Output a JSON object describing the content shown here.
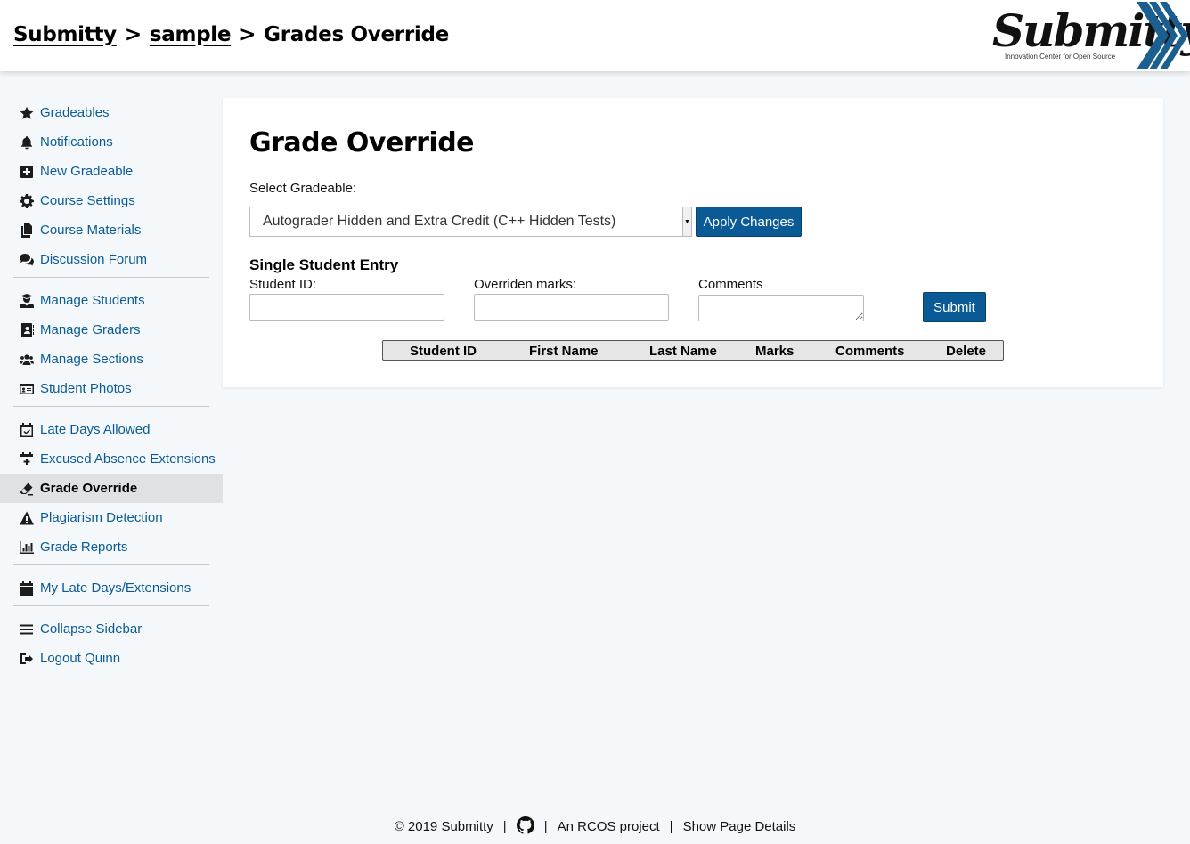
{
  "header": {
    "breadcrumb": [
      {
        "label": "Submitty"
      },
      {
        "label": "sample"
      },
      {
        "label": "Grades Override"
      }
    ],
    "separator": ">",
    "logo_text": "Submitty",
    "logo_tagline": "Innovation Center for Open Source"
  },
  "sidebar": {
    "groups": [
      [
        {
          "label": "Gradeables",
          "icon": "star-icon"
        },
        {
          "label": "Notifications",
          "icon": "bell-icon"
        },
        {
          "label": "New Gradeable",
          "icon": "plus-square-icon"
        },
        {
          "label": "Course Settings",
          "icon": "gear-icon"
        },
        {
          "label": "Course Materials",
          "icon": "copy-icon"
        },
        {
          "label": "Discussion Forum",
          "icon": "comments-icon"
        }
      ],
      [
        {
          "label": "Manage Students",
          "icon": "user-graduate-icon"
        },
        {
          "label": "Manage Graders",
          "icon": "address-book-icon"
        },
        {
          "label": "Manage Sections",
          "icon": "users-icon"
        },
        {
          "label": "Student Photos",
          "icon": "id-card-icon"
        }
      ],
      [
        {
          "label": "Late Days Allowed",
          "icon": "calendar-check-icon"
        },
        {
          "label": "Excused Absence Extensions",
          "icon": "calendar-plus-icon"
        },
        {
          "label": "Grade Override",
          "icon": "eraser-icon",
          "active": true
        },
        {
          "label": "Plagiarism Detection",
          "icon": "warning-icon"
        },
        {
          "label": "Grade Reports",
          "icon": "chart-bar-icon"
        }
      ],
      [
        {
          "label": "My Late Days/Extensions",
          "icon": "calendar-icon"
        }
      ],
      [
        {
          "label": "Collapse Sidebar",
          "icon": "bars-icon"
        },
        {
          "label": "Logout Quinn",
          "icon": "sign-out-icon"
        }
      ]
    ]
  },
  "main": {
    "title": "Grade Override",
    "select_label": "Select Gradeable:",
    "selected_gradeable": "Autograder Hidden and Extra Credit (C++ Hidden Tests)",
    "apply_button": "Apply Changes",
    "section_title": "Single Student Entry",
    "student_id_label": "Student ID:",
    "marks_label": "Overriden marks:",
    "comments_label": "Comments",
    "student_id_value": "",
    "marks_value": "",
    "comments_value": "",
    "submit_button": "Submit",
    "table_headers": [
      "Student ID",
      "First Name",
      "Last Name",
      "Marks",
      "Comments",
      "Delete"
    ]
  },
  "footer": {
    "copyright": "© 2019 Submitty",
    "github_icon": "github-icon",
    "rcos": "An RCOS project",
    "details": "Show Page Details",
    "separator": "|"
  },
  "colors": {
    "accent": "#0a5b95",
    "page_bg": "#f5f8fa",
    "active_bg": "#dfe2e5"
  }
}
